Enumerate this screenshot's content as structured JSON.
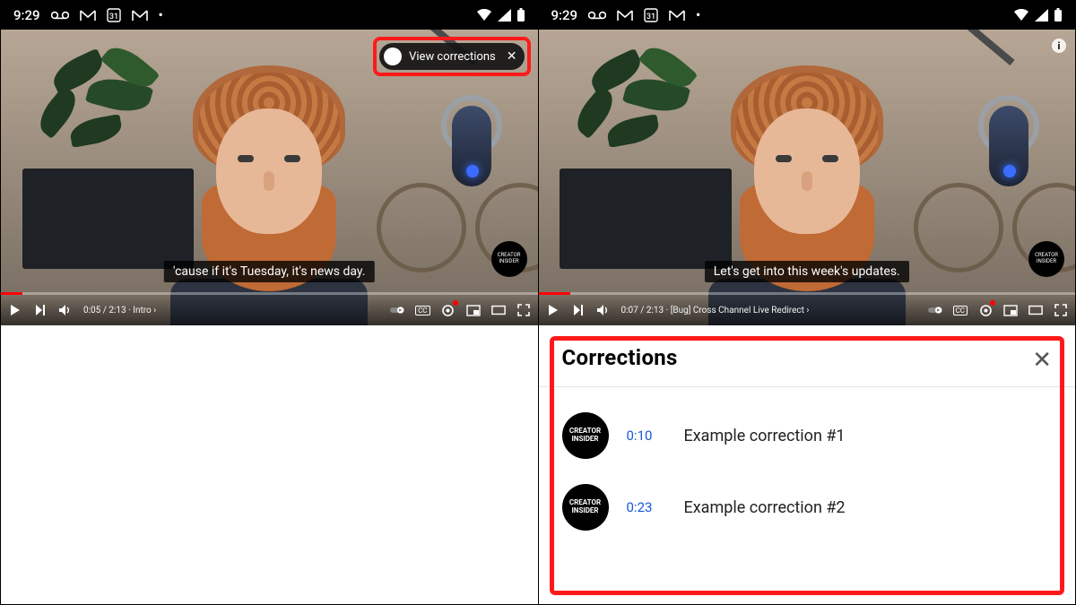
{
  "status": {
    "time": "9:29"
  },
  "left": {
    "caption": "'cause if it's Tuesday, it's news day.",
    "time_label": "0:05 / 2:13 · Intro",
    "progress_pct": 4,
    "pill_label": "View corrections",
    "channel_badge": "CREATOR INSIDER"
  },
  "right": {
    "caption": "Let's get into this week's updates.",
    "time_label": "0:07 / 2:13 · [Bug] Cross Channel Live Redirect",
    "progress_pct": 6,
    "channel_badge": "CREATOR INSIDER"
  },
  "panel": {
    "title": "Corrections",
    "avatar_text": "CREATOR INSIDER",
    "items": [
      {
        "ts": "0:10",
        "text": "Example correction #1"
      },
      {
        "ts": "0:23",
        "text": "Example correction #2"
      }
    ]
  }
}
